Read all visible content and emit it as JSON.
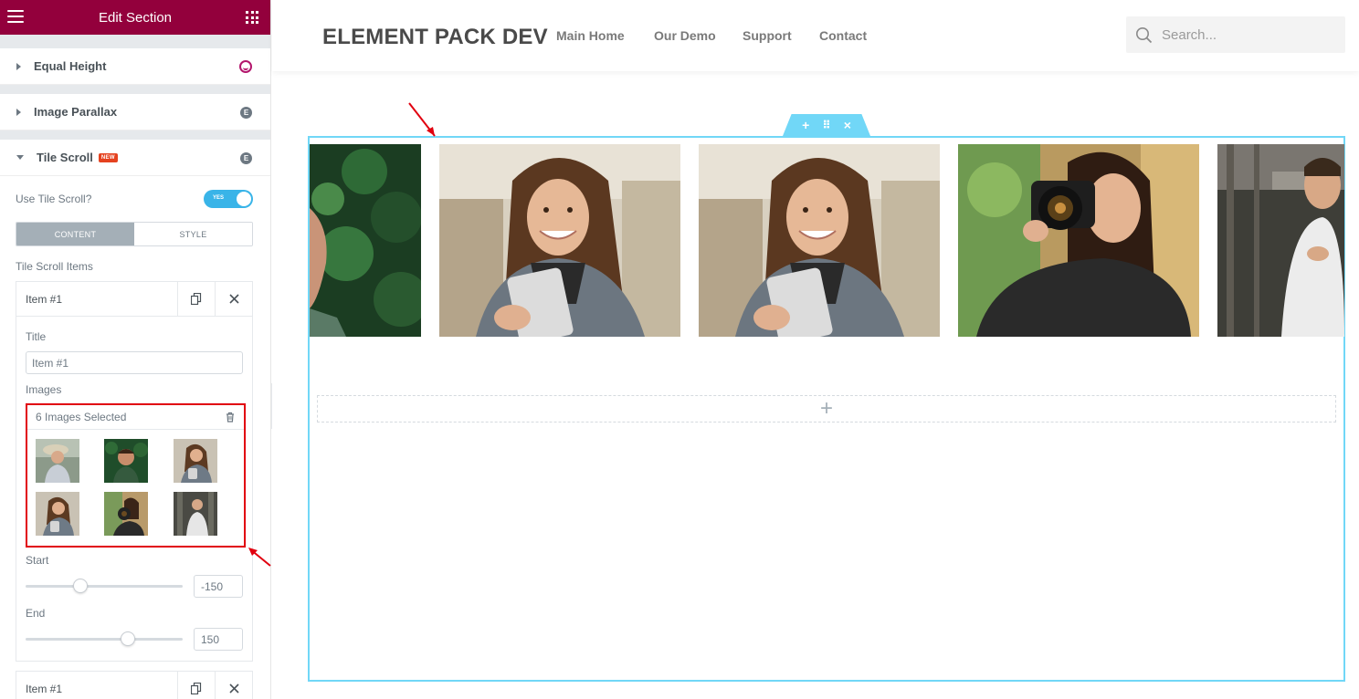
{
  "panel": {
    "header_title": "Edit Section",
    "sections": {
      "equal_height": "Equal Height",
      "image_parallax": "Image Parallax",
      "tile_scroll": "Tile Scroll",
      "new_badge": "NEW"
    },
    "use_tile_scroll_label": "Use Tile Scroll?",
    "toggle_text": "YES",
    "toggle_on": true,
    "tabs": {
      "content": "CONTENT",
      "style": "STYLE"
    },
    "tile_scroll_items_label": "Tile Scroll Items",
    "item1": {
      "title": "Item #1",
      "field_title_label": "Title",
      "field_title_value": "Item #1",
      "images_label": "Images",
      "images_selected": "6 Images Selected",
      "start_label": "Start",
      "start_value": "-150",
      "start_level": 0.35,
      "end_label": "End",
      "end_value": "150",
      "end_level": 0.65
    },
    "item2": {
      "title": "Item #1"
    }
  },
  "site": {
    "logo": "ELEMENT PACK DEV",
    "nav": [
      "Main Home",
      "Our Demo",
      "Support",
      "Contact"
    ],
    "search_placeholder": "Search..."
  },
  "section_handle": {
    "add": "+",
    "move": "⠿",
    "close": "×"
  },
  "add_zone_symbol": "+",
  "colors": {
    "panel_header": "#93003c",
    "accent_blue": "#71d7f7",
    "toggle_blue": "#39b4e8",
    "highlight_red": "#e1000f"
  },
  "icons": {
    "menu": "hamburger-icon",
    "widgets": "grid-icon",
    "duplicate": "copy-icon",
    "remove": "close-icon",
    "delete": "trash-icon",
    "search": "search-icon"
  }
}
